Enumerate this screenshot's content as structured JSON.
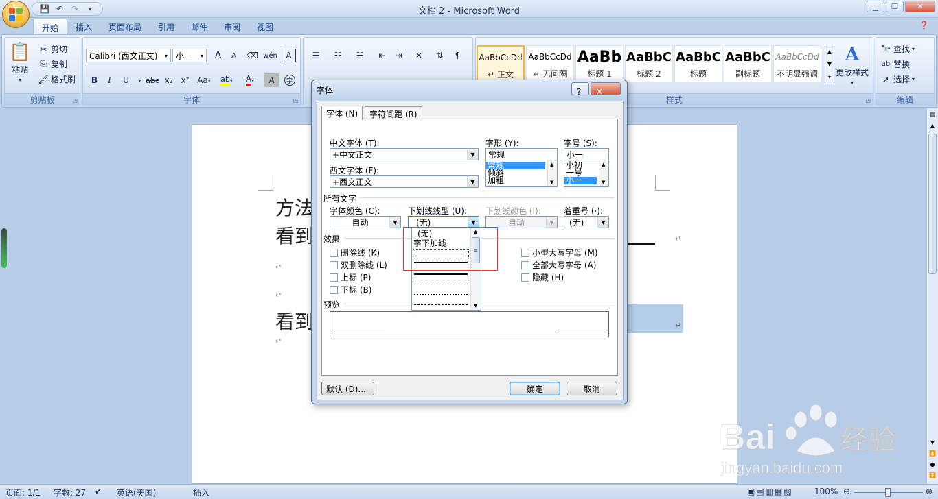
{
  "window": {
    "title": "文档 2 - Microsoft Word",
    "controls": [
      "minimize",
      "restore",
      "close"
    ]
  },
  "ribbon_tabs": [
    "开始",
    "插入",
    "页面布局",
    "引用",
    "邮件",
    "审阅",
    "视图"
  ],
  "clipboard": {
    "paste": "粘贴",
    "cut": "剪切",
    "copy": "复制",
    "format_painter": "格式刷",
    "group_label": "剪贴板"
  },
  "font_group": {
    "font_name": "Calibri (西文正文)",
    "font_size": "小一",
    "group_label": "字体",
    "bold": "B",
    "italic": "I",
    "underline": "U",
    "strike": "abc",
    "subscript": "x₂",
    "superscript": "x²",
    "change_case": "Aa",
    "phonetic": "wén",
    "clear": "A",
    "grow": "A",
    "shrink": "A",
    "char_border": "A",
    "enclose": "字",
    "font_color": "#e02020",
    "highlight_color": "#ffff00"
  },
  "styles_group": {
    "group_label": "样式",
    "items": [
      {
        "preview": "AaBbCcDd",
        "name": "↵ 正文",
        "size": 12,
        "bold": false,
        "italic": false,
        "color": "#000000"
      },
      {
        "preview": "AaBbCcDd",
        "name": "↵ 无间隔",
        "size": 12,
        "bold": false,
        "italic": false,
        "color": "#000000"
      },
      {
        "preview": "AaBb",
        "name": "标题 1",
        "size": 22,
        "bold": true,
        "italic": false,
        "color": "#000000"
      },
      {
        "preview": "AaBbC",
        "name": "标题 2",
        "size": 18,
        "bold": true,
        "italic": false,
        "color": "#000000"
      },
      {
        "preview": "AaBbC",
        "name": "标题",
        "size": 18,
        "bold": true,
        "italic": false,
        "color": "#000000"
      },
      {
        "preview": "AaBbC",
        "name": "副标题",
        "size": 18,
        "bold": true,
        "italic": false,
        "color": "#000000"
      },
      {
        "preview": "AaBbCcDd",
        "name": "不明显强调",
        "size": 12,
        "bold": false,
        "italic": true,
        "color": "#888888"
      }
    ],
    "change_styles": "更改样式"
  },
  "editing_group": {
    "find": "查找",
    "replace": "替换",
    "select": "选择",
    "group_label": "编辑"
  },
  "document": {
    "lines": [
      "方法",
      "看到",
      "看到"
    ],
    "para_mark": "↵"
  },
  "status_bar": {
    "page": "页面: 1/1",
    "words": "字数: 27",
    "language": "英语(美国)",
    "mode": "插入",
    "zoom": "100%"
  },
  "dialog": {
    "title": "字体",
    "help_btn": "?",
    "close_btn": "✕",
    "tabs": [
      "字体 (N)",
      "字符间距 (R)"
    ],
    "chinese_font_label": "中文字体 (T):",
    "chinese_font_value": "+中文正文",
    "western_font_label": "西文字体 (F):",
    "western_font_value": "+西文正文",
    "style_label": "字形 (Y):",
    "style_value": "常规",
    "style_options": [
      "常规",
      "倾斜",
      "加粗"
    ],
    "size_label": "字号 (S):",
    "size_value": "小一",
    "size_options": [
      "小初",
      "一号",
      "小一"
    ],
    "all_text_label": "所有文字",
    "font_color_label": "字体颜色 (C):",
    "font_color_value": "自动",
    "underline_style_label": "下划线线型 (U):",
    "underline_style_value": "(无)",
    "underline_color_label": "下划线颜色 (I):",
    "underline_color_value": "自动",
    "emphasis_label": "着重号 (·):",
    "emphasis_value": "(无)",
    "effects_label": "效果",
    "effects_left": [
      "删除线 (K)",
      "双删除线 (L)",
      "上标 (P)",
      "下标 (B)"
    ],
    "effects_right": [
      "小型大写字母 (M)",
      "全部大写字母 (A)",
      "隐藏 (H)"
    ],
    "preview_label": "预览",
    "default_btn": "默认 (D)...",
    "ok_btn": "确定",
    "cancel_btn": "取消",
    "underline_dropdown": {
      "none_option": "(无)",
      "words_option": "字下加线",
      "line_styles": [
        "single-selected",
        "double",
        "thick",
        "dotted",
        "dotted-bold",
        "dashed"
      ]
    }
  },
  "watermark": {
    "brand": "Bai du 经验",
    "url": "jingyan.baidu.com"
  },
  "colors": {
    "ribbon_blue": "#15428b",
    "selection": "#3399ff",
    "highlight_box": "#e23c3c",
    "doc_selection": "#b4cde8"
  }
}
